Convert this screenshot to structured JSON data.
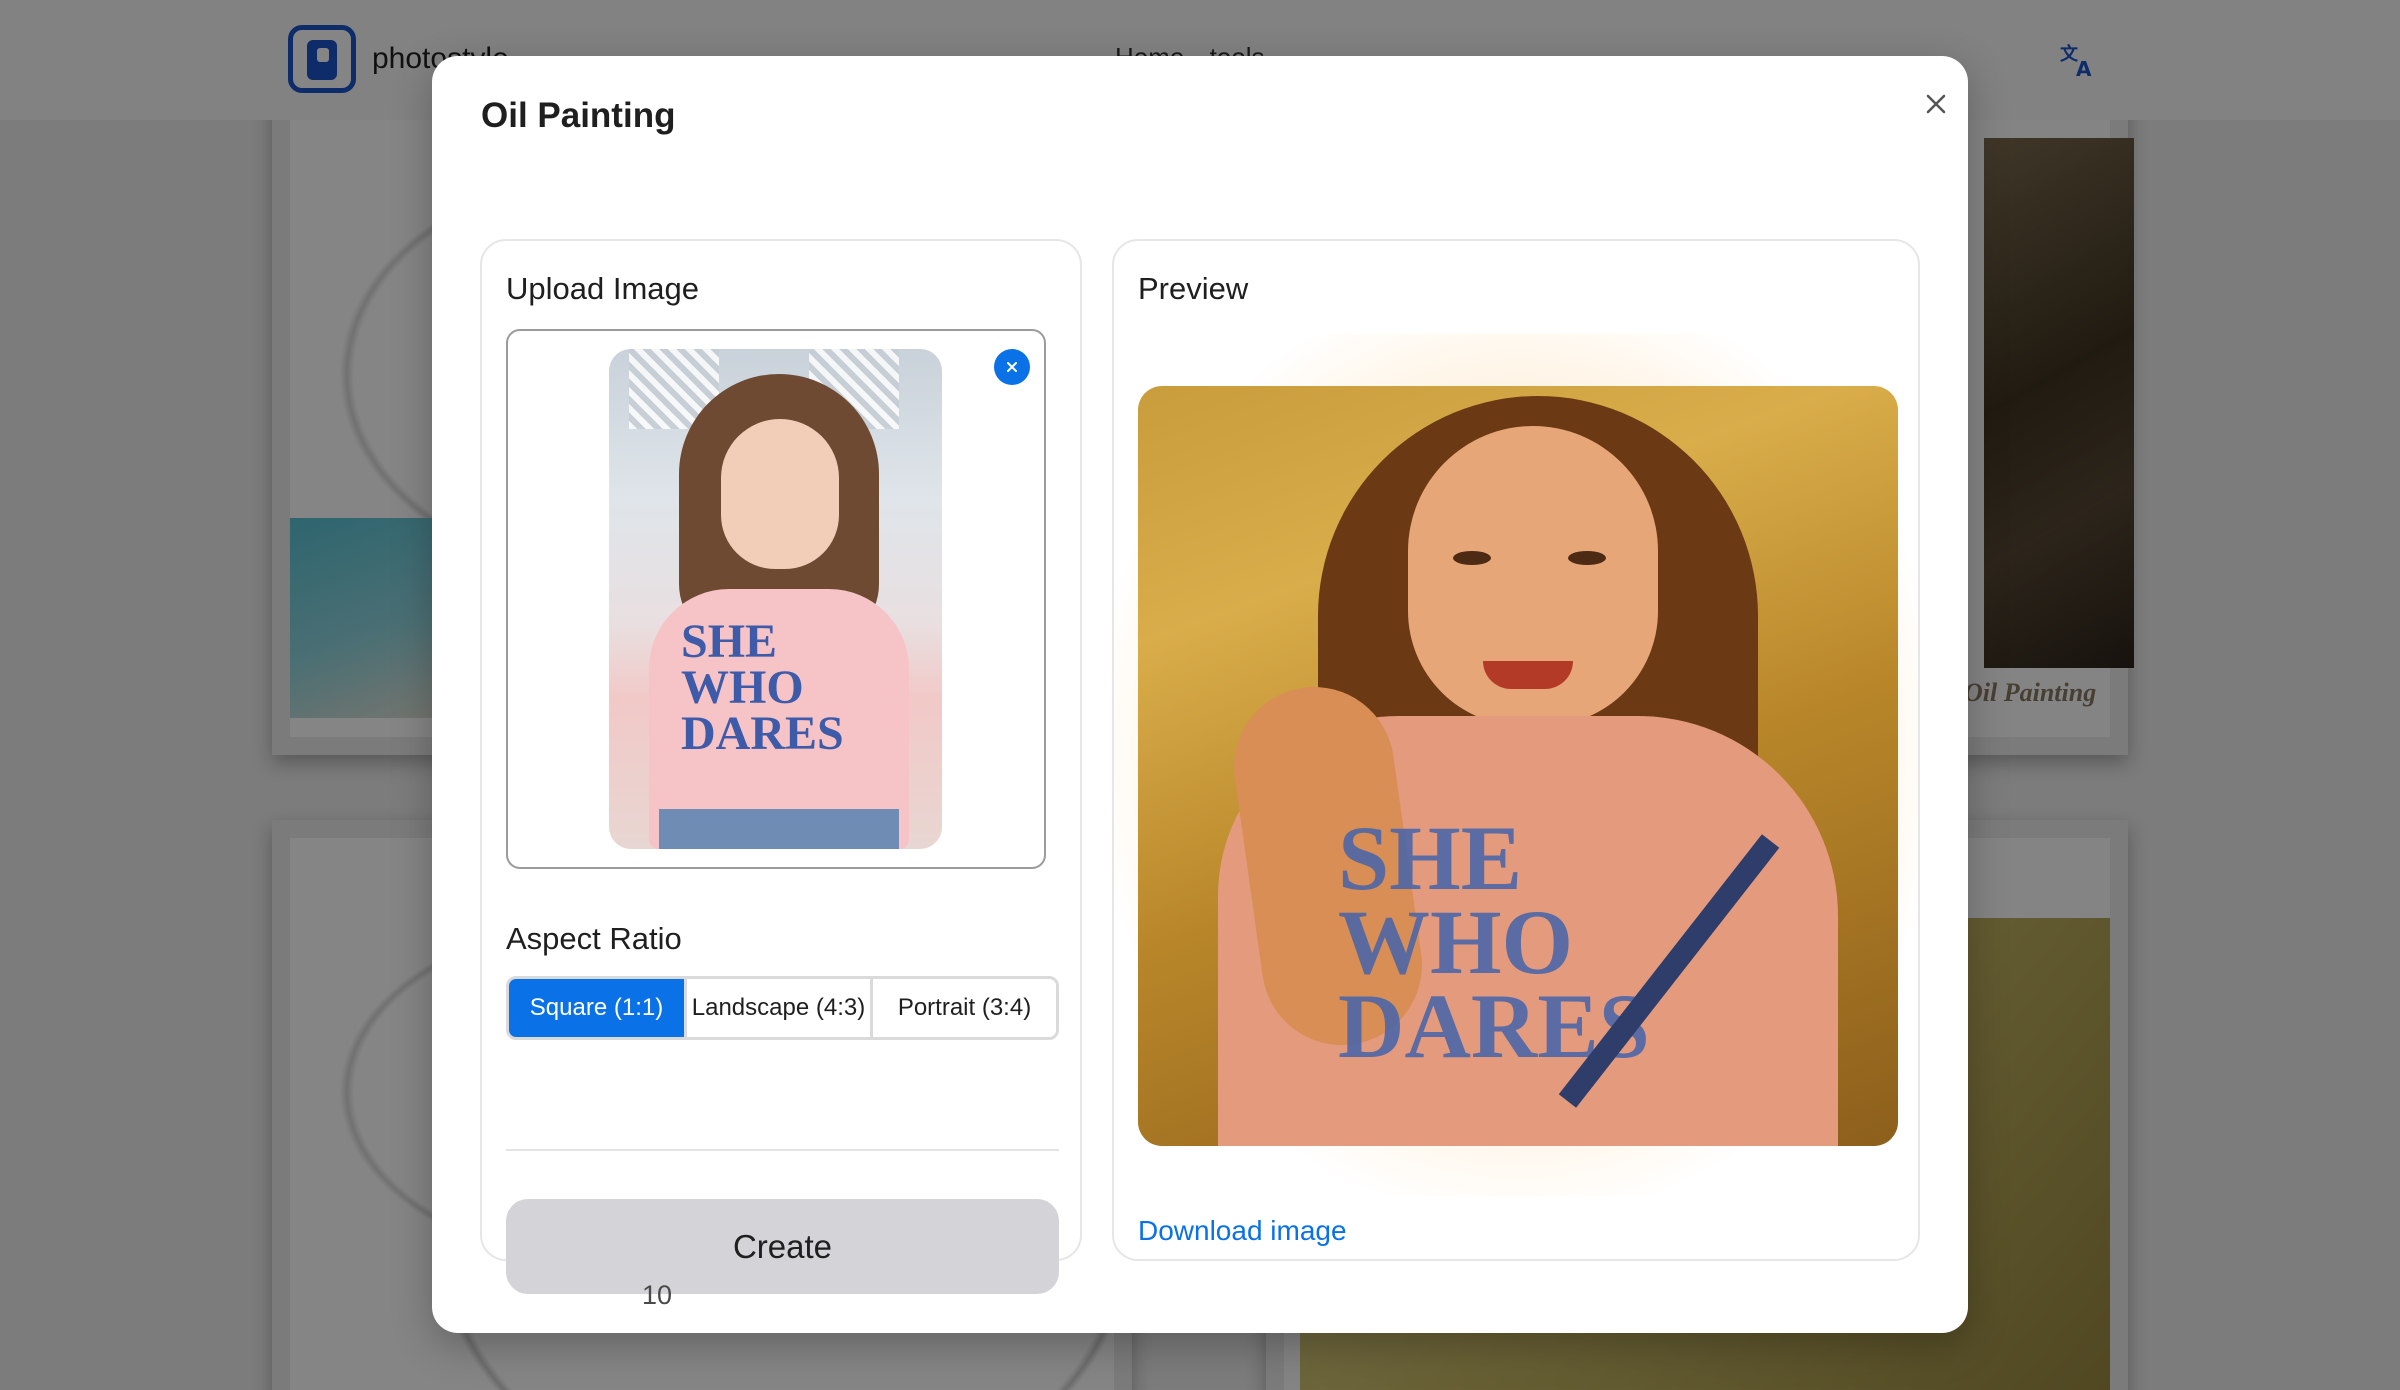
{
  "background": {
    "brand_name": "photostyle",
    "nav_text": "Home   tools",
    "caption_right": "Oil Painting"
  },
  "modal": {
    "title": "Oil Painting",
    "close_label": "×"
  },
  "upload": {
    "label": "Upload Image",
    "thumbnail_text": "SHE\nWHO\nDARES"
  },
  "aspect_ratio": {
    "label": "Aspect Ratio",
    "options": [
      "Square (1:1)",
      "Landscape (4:3)",
      "Portrait (3:4)"
    ],
    "selected": "Square (1:1)"
  },
  "create": {
    "label": "Create",
    "count_text": "10"
  },
  "preview": {
    "label": "Preview",
    "painted_text": "SHE\nWHO\nDARES",
    "download_label": "Download image"
  },
  "colors": {
    "accent": "#0a72e6",
    "create_button_bg": "#d4d4d8"
  }
}
